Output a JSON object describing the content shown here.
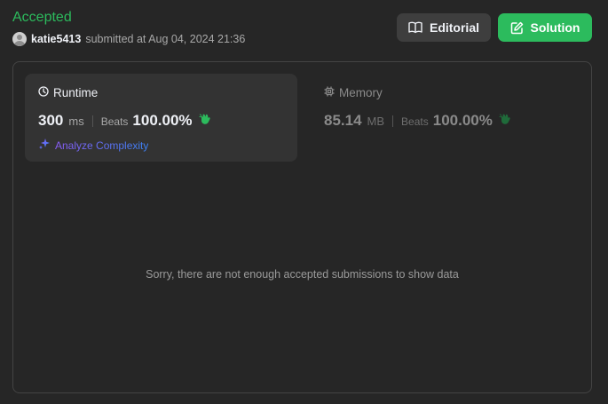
{
  "result": {
    "status": "Accepted",
    "status_color": "#2cbb5d",
    "username": "katie5413",
    "submitted_text": "submitted at Aug 04, 2024 21:36"
  },
  "actions": {
    "editorial_label": "Editorial",
    "solution_label": "Solution"
  },
  "runtime": {
    "title": "Runtime",
    "value": "300",
    "unit": "ms",
    "beats_label": "Beats",
    "beats_value": "100.00%",
    "icon": "clock-icon",
    "analyze_label": "Analyze Complexity"
  },
  "memory": {
    "title": "Memory",
    "value": "85.14",
    "unit": "MB",
    "beats_label": "Beats",
    "beats_value": "100.00%",
    "icon": "chip-icon"
  },
  "chart": {
    "empty_message": "Sorry, there are not enough accepted submissions to show data"
  }
}
